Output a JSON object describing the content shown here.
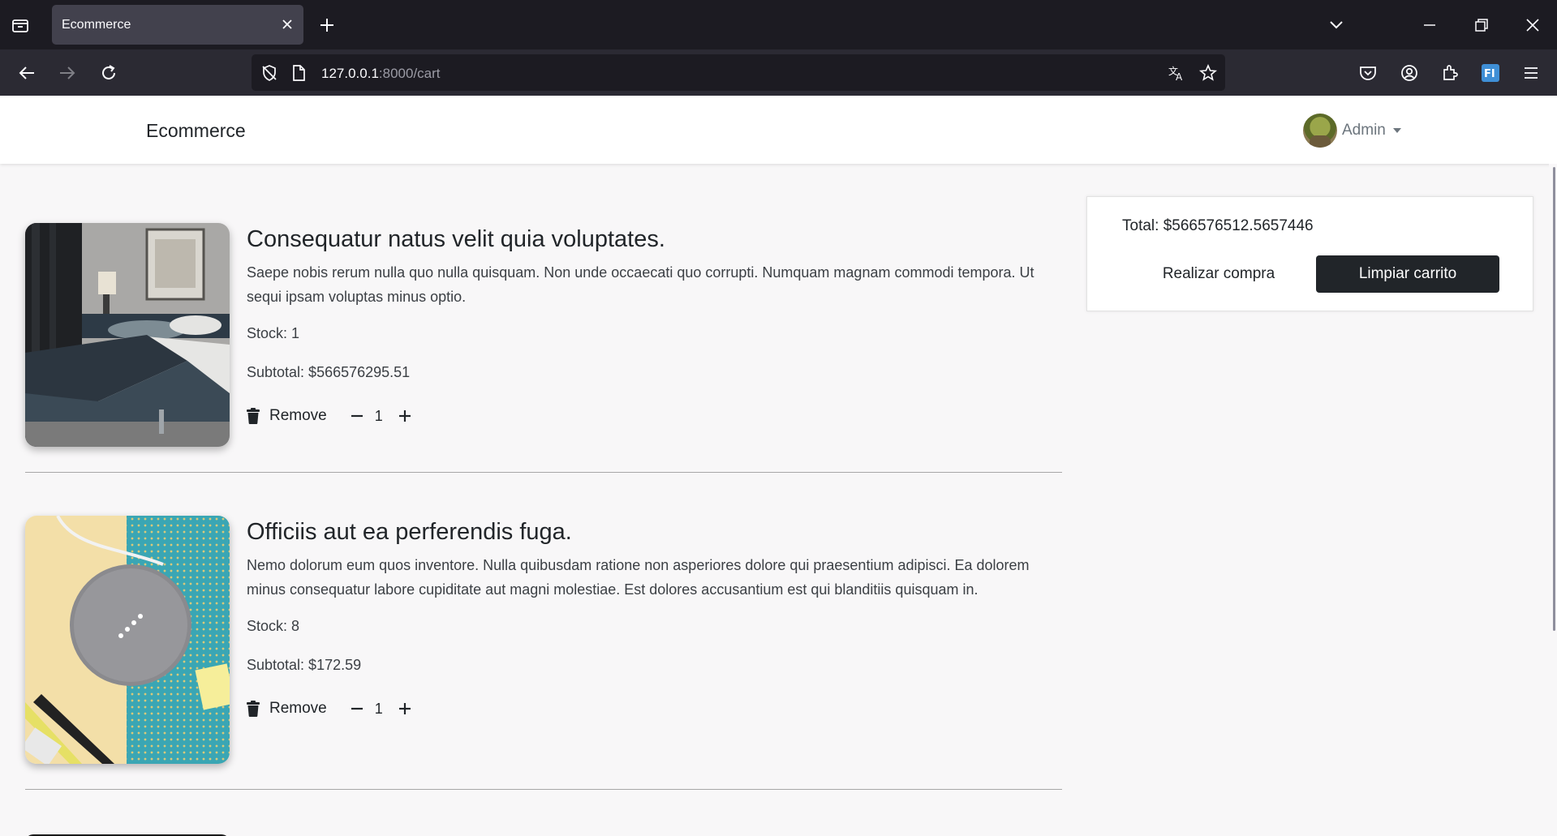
{
  "browser": {
    "tab_title": "Ecommerce",
    "url_host": "127.0.0.1",
    "url_path": ":8000/cart"
  },
  "site": {
    "brand": "Ecommerce",
    "user_name": "Admin"
  },
  "cart": {
    "items": [
      {
        "title": "Consequatur natus velit quia voluptates.",
        "description": "Saepe nobis rerum nulla quo nulla quisquam. Non unde occaecati quo corrupti. Numquam magnam commodi tempora. Ut sequi ipsam voluptas minus optio.",
        "stock": "Stock: 1",
        "subtotal": "Subtotal: $566576295.51",
        "remove_label": "Remove",
        "quantity": "1"
      },
      {
        "title": "Officiis aut ea perferendis fuga.",
        "description": "Nemo dolorum eum quos inventore. Nulla quibusdam ratione non asperiores dolore qui praesentium adipisci. Ea dolorem minus consequatur labore cupiditate aut magni molestiae. Est dolores accusantium est qui blanditiis quisquam in.",
        "stock": "Stock: 8",
        "subtotal": "Subtotal: $172.59",
        "remove_label": "Remove",
        "quantity": "1"
      }
    ]
  },
  "summary": {
    "total": "Total: $566576512.5657446",
    "buy_label": "Realizar compra",
    "clear_label": "Limpiar carrito"
  },
  "colors": {
    "chrome_dark": "#1c1b22",
    "chrome_toolbar": "#2b2a33",
    "page_bg": "#f8f7f8",
    "primary_dark": "#212529"
  }
}
